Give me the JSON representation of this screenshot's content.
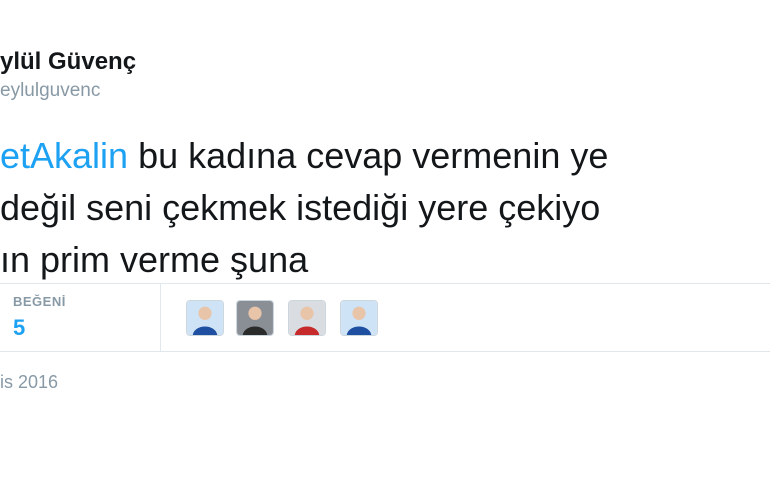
{
  "tweet": {
    "display_name": "ylül Güvenç",
    "handle": "eylulguvenc",
    "lines": [
      {
        "mention": "etAkalin",
        "text": " bu kadına cevap vermenin ye"
      },
      {
        "mention": "",
        "text": " değil seni çekmek istediği yere çekiyo"
      },
      {
        "mention": "",
        "text": "ın prim verme şuna"
      }
    ],
    "timestamp": "is 2016"
  },
  "stats": {
    "likes_label": "BEĞENİ",
    "likes_count": "5"
  },
  "likers": [
    {
      "icon": "liker-avatar-1",
      "bg": "#cfe3f7",
      "fg": "#1f4fa0"
    },
    {
      "icon": "liker-avatar-2",
      "bg": "#8a8f96",
      "fg": "#2b2b2b"
    },
    {
      "icon": "liker-avatar-3",
      "bg": "#d9dde2",
      "fg": "#c62a2a"
    },
    {
      "icon": "liker-avatar-4",
      "bg": "#cfe3f7",
      "fg": "#1f4fa0"
    }
  ],
  "colors": {
    "link": "#1da1f2",
    "muted": "#8899a6",
    "text": "#14171a",
    "border": "#e1e8ed"
  }
}
